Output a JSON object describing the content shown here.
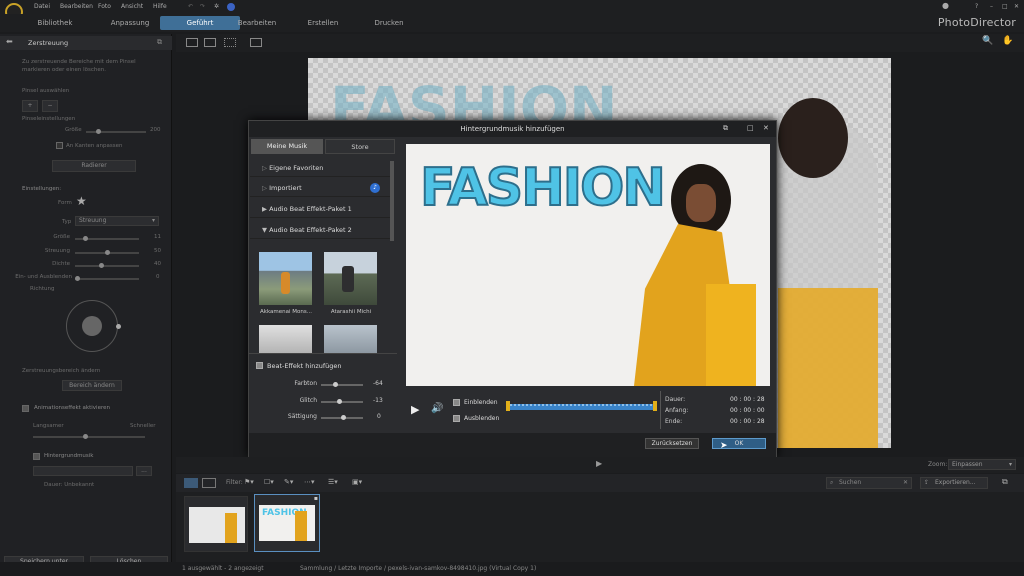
{
  "menu": {
    "items": [
      "Datei",
      "Bearbeiten",
      "Foto",
      "Ansicht",
      "Hilfe"
    ]
  },
  "tabs": {
    "items": [
      "Bibliothek",
      "Anpassung",
      "Geführt",
      "Bearbeiten",
      "Erstellen",
      "Drucken"
    ],
    "active": "Geführt"
  },
  "brand": "PhotoDirector",
  "left_panel": {
    "title": "Zerstreuung",
    "hint": "Zu zerstreuende Bereiche mit dem Pinsel markieren oder einen löschen.",
    "brush_label": "Pinsel auswählen",
    "brush_settings": "Pinseleinstellungen",
    "size_label": "Größe",
    "size_value": "200",
    "edge_checkbox": "An Kanten anpassen",
    "eraser_button": "Radierer",
    "settings_label": "Einstellungen:",
    "form_label": "Form",
    "type_label": "Typ",
    "type_value": "Streuung",
    "sliders": [
      {
        "label": "Größe",
        "value": "11"
      },
      {
        "label": "Streuung",
        "value": "50"
      },
      {
        "label": "Dichte",
        "value": "40"
      },
      {
        "label": "Ein- und Ausblenden",
        "value": "0"
      }
    ],
    "direction_label": "Richtung",
    "area_label": "Zerstreuungsbereich ändern",
    "area_button": "Bereich ändern",
    "anim_checkbox": "Animationseffekt aktivieren",
    "speed_slow": "Langsamer",
    "speed_fast": "Schneller",
    "music_checkbox": "Hintergrundmusik",
    "music_more": "...",
    "duration_text": "Dauer: Unbekannt",
    "save_button": "Speichern unter",
    "delete_button": "Löschen"
  },
  "dialog": {
    "title": "Hintergrundmusik hinzufügen",
    "tabs": [
      "Meine Musik",
      "Store"
    ],
    "categories": [
      "Eigene Favoriten",
      "Importiert",
      "Audio Beat Effekt-Paket 1",
      "Audio Beat Effekt-Paket 2"
    ],
    "thumbs": [
      "Akkamenai Mons...",
      "Atarashii Michi"
    ],
    "beat_checkbox": "Beat-Effekt hinzufügen",
    "fx": [
      {
        "label": "Farbton",
        "value": "-64"
      },
      {
        "label": "Glitch",
        "value": "-13"
      },
      {
        "label": "Sättigung",
        "value": "0"
      }
    ],
    "fade_in": "Einblenden",
    "fade_out": "Ausblenden",
    "duration_label": "Dauer:",
    "duration_value": "00 : 00 : 28",
    "start_label": "Anfang:",
    "start_value": "00 : 00 : 00",
    "end_label": "Ende:",
    "end_value": "00 : 00 : 28",
    "reset_button": "Zurücksetzen",
    "ok_button": "OK",
    "preview_text": "FASHION"
  },
  "bottom": {
    "zoom_label": "Zoom:",
    "zoom_value": "Einpassen",
    "filter_label": "Filter:",
    "search_placeholder": "Suchen",
    "export_button": "Exportieren..."
  },
  "status": {
    "left": "1 ausgewählt - 2 angezeigt",
    "center": "Sammlung / Letzte Importe / pexels-ivan-samkov-8498410.jpg (Virtual Copy 1)"
  },
  "colors": {
    "accent": "#3f6f97",
    "ok_blue": "#2f5e86",
    "fashion_cyan": "#4fc3e6",
    "jacket": "#e6a820"
  }
}
